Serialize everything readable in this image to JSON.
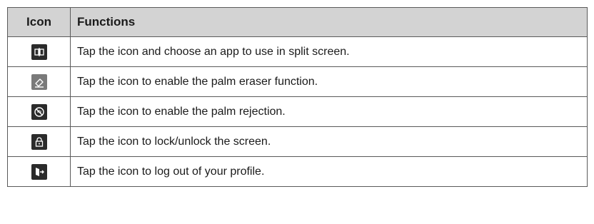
{
  "table": {
    "headers": {
      "icon": "Icon",
      "functions": "Functions"
    },
    "rows": [
      {
        "icon": "split-screen-icon",
        "icon_bg": "#2b2b2b",
        "description": "Tap the icon and choose an app to use in split screen."
      },
      {
        "icon": "palm-eraser-icon",
        "icon_bg": "#7a7a7a",
        "description": "Tap the icon to enable the palm eraser function."
      },
      {
        "icon": "palm-rejection-icon",
        "icon_bg": "#2b2b2b",
        "description": "Tap the icon to enable the palm rejection."
      },
      {
        "icon": "lock-icon",
        "icon_bg": "#2b2b2b",
        "description": "Tap the icon to lock/unlock the screen."
      },
      {
        "icon": "logout-icon",
        "icon_bg": "#2b2b2b",
        "description": "Tap the icon to log out of your profile."
      }
    ]
  }
}
